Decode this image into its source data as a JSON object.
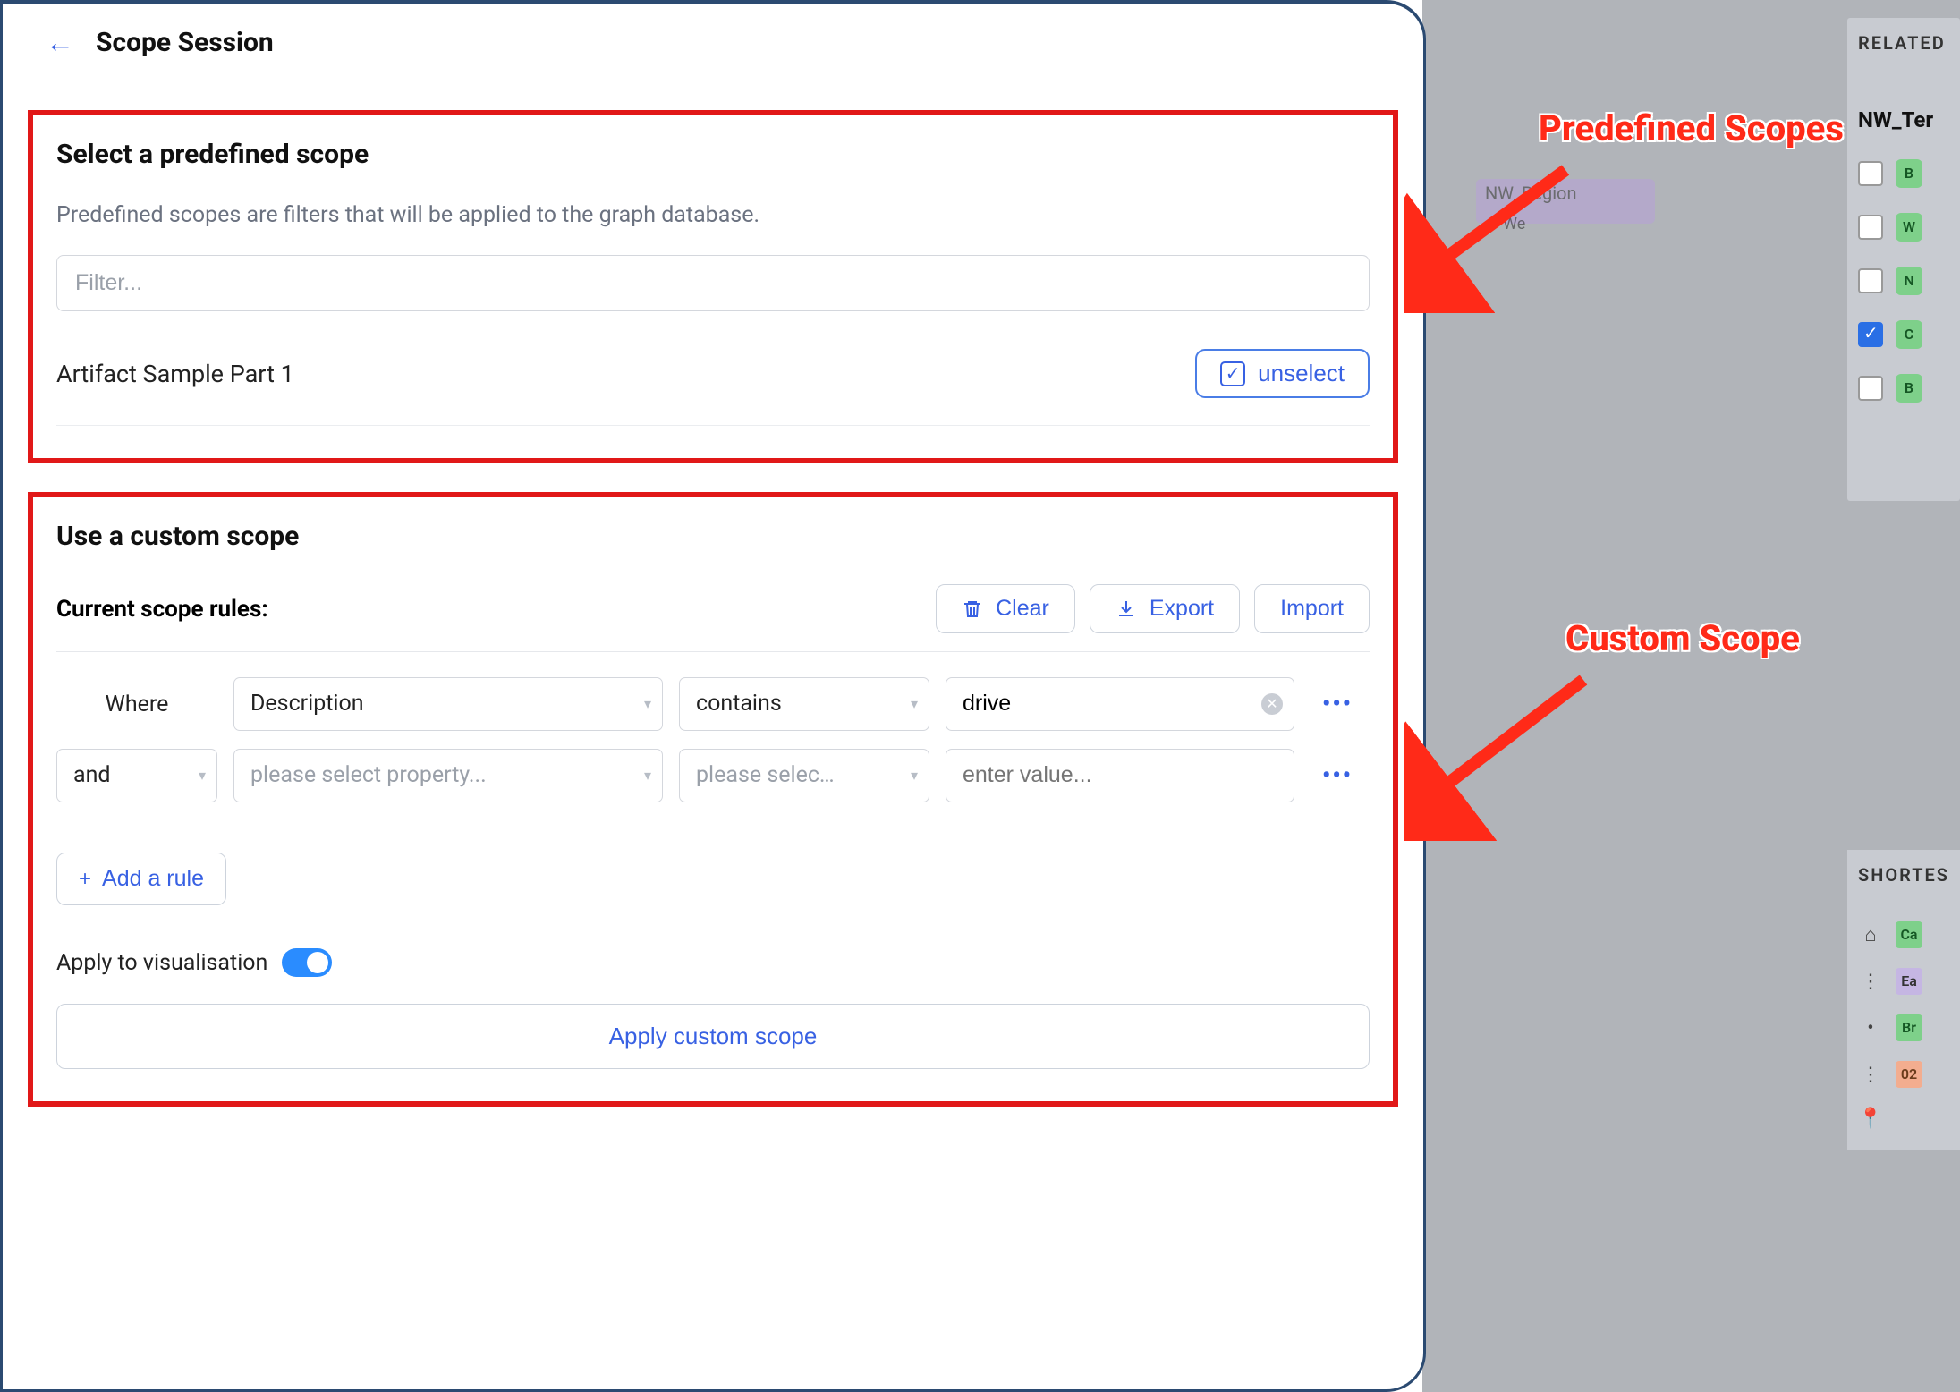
{
  "dialog": {
    "title": "Scope Session"
  },
  "predefined": {
    "heading": "Select a predefined scope",
    "description": "Predefined scopes are filters that will be applied to the graph database.",
    "filter_placeholder": "Filter...",
    "item_name": "Artifact Sample Part 1",
    "unselect_label": "unselect"
  },
  "custom": {
    "heading": "Use a custom scope",
    "rules_label": "Current scope rules:",
    "actions": {
      "clear": "Clear",
      "export": "Export",
      "import": "Import"
    },
    "rule1": {
      "where": "Where",
      "property": "Description",
      "condition": "contains",
      "value": "drive"
    },
    "rule2": {
      "conjunction": "and",
      "property_placeholder": "please select property...",
      "condition_placeholder": "please selec…",
      "value_placeholder": "enter value..."
    },
    "add_rule": "Add a rule",
    "apply_vis_label": "Apply to visualisation",
    "apply_button": "Apply custom scope"
  },
  "annotations": {
    "predefined": "Predefined Scopes",
    "custom": "Custom Scope"
  },
  "backdrop": {
    "related_header": "RELATED",
    "related_sub": "NW_Ter",
    "shortest_header": "SHORTES",
    "node_label": "NW_Region",
    "subnode_label": "We",
    "related_items": [
      "B",
      "W",
      "N",
      "C",
      "B"
    ],
    "related_checked_index": 3,
    "shortest_items": [
      {
        "icon": "home",
        "label": "Ca",
        "color": "green"
      },
      {
        "icon": "dots",
        "label": "Ea",
        "color": "lav"
      },
      {
        "icon": "dot",
        "label": "Br",
        "color": "green"
      },
      {
        "icon": "dots",
        "label": "02",
        "color": "orange"
      },
      {
        "icon": "pin",
        "label": "",
        "color": ""
      }
    ]
  }
}
